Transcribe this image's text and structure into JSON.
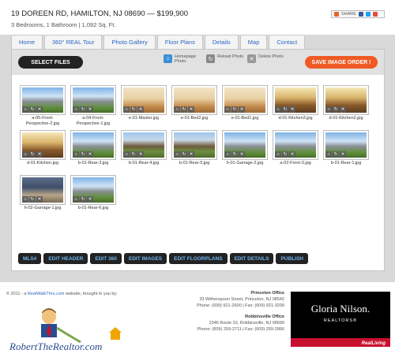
{
  "header": {
    "address": "19 DOREEN RD, HAMILTON, NJ 08690",
    "separator": "—",
    "price": "$199,900",
    "details": "3 Bedrooms, 1 Bathroom | 1,092 Sq. Ft.",
    "share_label": "SHARE"
  },
  "tabs": [
    "Home",
    "360° REAL Tour",
    "Photo Gallery",
    "Floor Plans",
    "Details",
    "Map",
    "Contact"
  ],
  "toolbar": {
    "select_files": "SELECT FILES",
    "save_order": "SAVE IMAGE ORDER !",
    "legend_homepage": "Homepage Photo",
    "legend_reload": "Reload Photo",
    "legend_delete": "Delete Photo"
  },
  "photos": [
    {
      "file": "a-05-Front-Perspective-2.jpg",
      "icon": "exterior"
    },
    {
      "file": "a-04-Front-Perspective-1.jpg",
      "icon": "exterior"
    },
    {
      "file": "e-01-Master.jpg",
      "icon": "bedroom"
    },
    {
      "file": "e-01-Bed2.jpg",
      "icon": "bedroom"
    },
    {
      "file": "e-01-Bed1.jpg",
      "icon": "bedroom"
    },
    {
      "file": "d-01-Kitchen3.jpg",
      "icon": "kitchen"
    },
    {
      "file": "d-01-Kitchen2.jpg",
      "icon": "kitchen"
    },
    {
      "file": "d-01-Kitchen.jpg",
      "icon": "kitchen"
    },
    {
      "file": "b-01-Rear-3.jpg",
      "icon": "exterior"
    },
    {
      "file": "b-01-Rear-4.jpg",
      "icon": "yard"
    },
    {
      "file": "b-01-Rear-5.jpg",
      "icon": "yard"
    },
    {
      "file": "h-01-Garrage-2.jpg",
      "icon": "exterior"
    },
    {
      "file": "a-02-Front-3.jpg",
      "icon": "exterior"
    },
    {
      "file": "b-01-Rear-1.jpg",
      "icon": "exterior"
    },
    {
      "file": "h-02-Garrage-1.jpg",
      "icon": "garage"
    },
    {
      "file": "b-01-Rear-6.jpg",
      "icon": "exterior"
    }
  ],
  "actions": [
    "MLS#",
    "EDIT HEADER",
    "EDIT 360",
    "EDIT IMAGES",
    "EDIT FLOORPLANS",
    "EDIT DETAILS",
    "PUBLISH"
  ],
  "footer": {
    "copyright_prefix": "© 2011 - a",
    "copyright_link": "RealWalkThru.com",
    "copyright_suffix": "website, brought to you by:",
    "logo_text": "RobertTheRealtor.com",
    "office1_title": "Princeton Office",
    "office1_address": "33 Witherspoon Street, Princeton, NJ 08542",
    "office1_phone": "Phone: (609) 921-2600 | Fax: (609) 921-3299",
    "office2_title": "Robbinsville Office",
    "office2_address": "2346 Route 33, Robbinsville, NJ 08690",
    "office2_phone": "Phone: (609) 259-2711 | Fax: (609) 259-2866",
    "brand_name": "Gloria Nilson.",
    "brand_sub": "REALTORS®",
    "brand_badge": "RealLiving"
  },
  "colors": {
    "accent_orange": "#ef5a24",
    "link_blue": "#2b66c2",
    "dark_button": "#222222",
    "button_text_blue": "#6fb3f0",
    "brand_red": "#c8102e"
  }
}
